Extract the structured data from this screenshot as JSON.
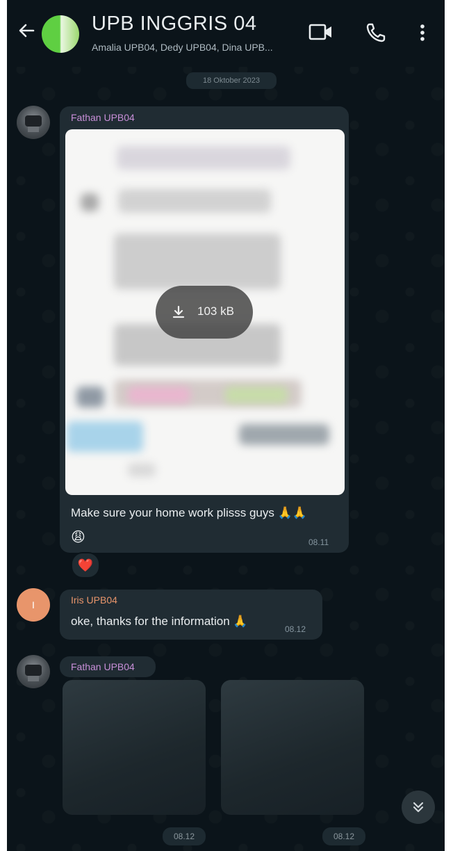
{
  "header": {
    "title": "UPB INGGRIS 04",
    "members": "Amalia UPB04, Dedy UPB04, Dina UPB..."
  },
  "date_chip": "18 Oktober 2023",
  "messages": [
    {
      "sender": "Fathan UPB04",
      "sender_color": "#c78ed7",
      "attachment_size": "103 kB",
      "text": "Make sure your home work plisss guys 🙏🙏",
      "emoji_line": "😩",
      "time": "08.11",
      "reaction": "❤️"
    },
    {
      "sender": "Iris UPB04",
      "avatar_letter": "I",
      "sender_color": "#e8956b",
      "text": "oke, thanks for the information 🙏",
      "time": "08.12"
    },
    {
      "sender": "Fathan UPB04",
      "sender_color": "#c78ed7",
      "media_times": [
        "08.12",
        "08.12"
      ]
    }
  ],
  "colors": {
    "background": "#0b141a",
    "bubble": "#202c33",
    "text": "#e9edef",
    "meta": "#8696a0"
  },
  "icons": [
    "back-arrow-icon",
    "video-call-icon",
    "voice-call-icon",
    "more-options-icon",
    "download-icon",
    "scroll-down-icon"
  ]
}
